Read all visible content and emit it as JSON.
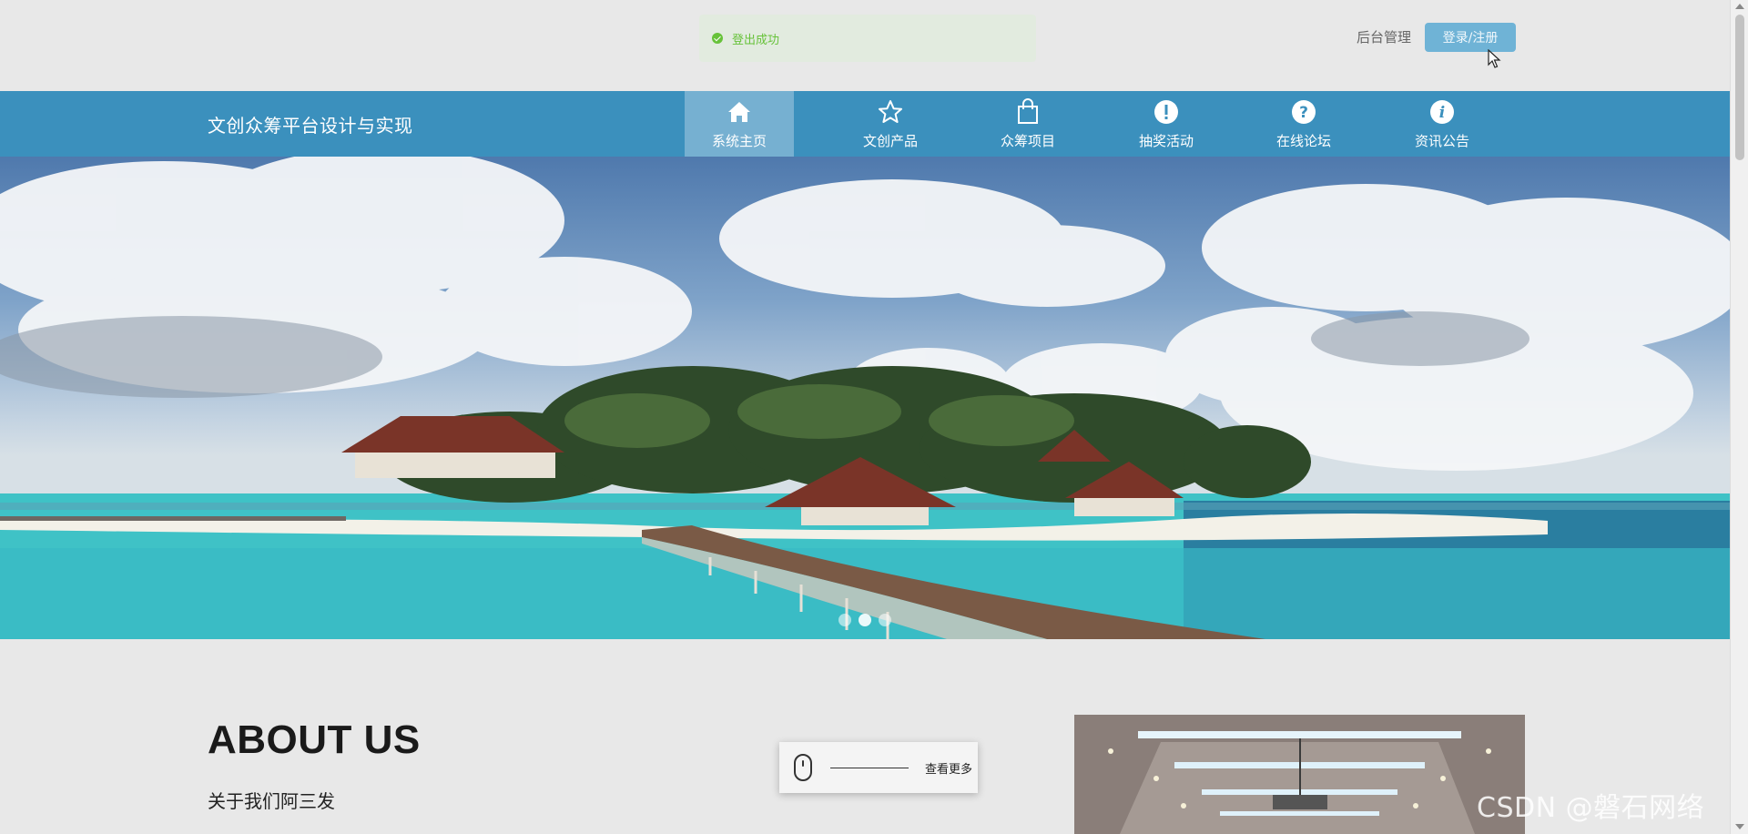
{
  "toast": {
    "message": "登出成功",
    "icon": "check-circle-icon",
    "color": "#67c23a"
  },
  "header": {
    "admin_label": "后台管理",
    "login_label": "登录/注册",
    "accent": "#6fb3d6"
  },
  "nav": {
    "site_title": "文创众筹平台设计与实现",
    "background": "#3b90bd",
    "items": [
      {
        "label": "系统主页",
        "icon": "home-icon",
        "active": true
      },
      {
        "label": "文创产品",
        "icon": "star-icon",
        "active": false
      },
      {
        "label": "众筹项目",
        "icon": "shopping-bag-icon",
        "active": false
      },
      {
        "label": "抽奖活动",
        "icon": "exclamation-circle-icon",
        "active": false
      },
      {
        "label": "在线论坛",
        "icon": "question-circle-icon",
        "active": false
      },
      {
        "label": "资讯公告",
        "icon": "info-circle-icon",
        "active": false
      }
    ]
  },
  "banner": {
    "image": "tropical island resort with wooden pier",
    "slides": 3,
    "active_slide": 2
  },
  "about": {
    "heading": "ABOUT US",
    "subtitle": "关于我们阿三发",
    "more_label": "查看更多"
  },
  "watermark": "CSDN @磐石网络"
}
